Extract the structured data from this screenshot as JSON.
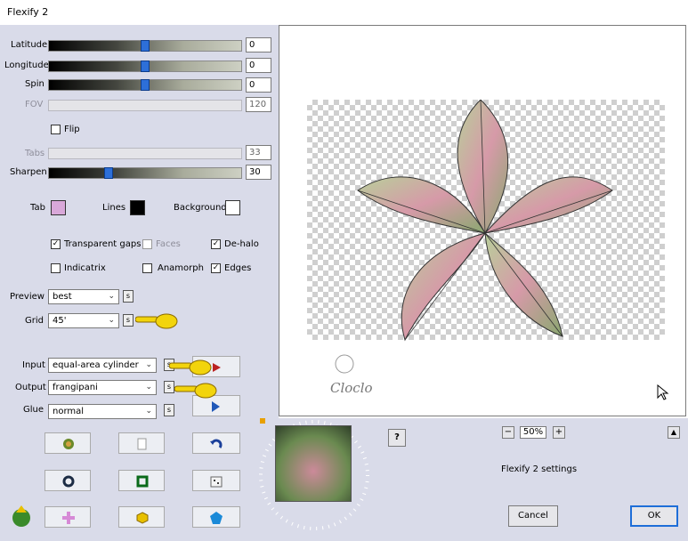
{
  "window": {
    "title": "Flexify 2"
  },
  "sliders": {
    "latitude": {
      "label": "Latitude",
      "value": "0",
      "level": 0.5
    },
    "longitude": {
      "label": "Longitude",
      "value": "0",
      "level": 0.5
    },
    "spin": {
      "label": "Spin",
      "value": "0",
      "level": 0.5
    },
    "fov": {
      "label": "FOV",
      "value": "120"
    },
    "tabs": {
      "label": "Tabs",
      "value": "33"
    },
    "sharpen": {
      "label": "Sharpen",
      "value": "30",
      "level": 0.3
    }
  },
  "flip": {
    "label": "Flip",
    "checked": false
  },
  "colors": {
    "tab": {
      "label": "Tab",
      "color": "#d9a8d9"
    },
    "lines": {
      "label": "Lines",
      "color": "#000000"
    },
    "background": {
      "label": "Background",
      "color": "#ffffff"
    }
  },
  "checkboxes": {
    "transparent_gaps": {
      "label": "Transparent gaps",
      "checked": true
    },
    "faces": {
      "label": "Faces",
      "checked": false
    },
    "dehalo": {
      "label": "De-halo",
      "checked": true
    },
    "indicatrix": {
      "label": "Indicatrix",
      "checked": false
    },
    "anamorph": {
      "label": "Anamorph",
      "checked": false
    },
    "edges": {
      "label": "Edges",
      "checked": true
    }
  },
  "selects": {
    "preview": {
      "label": "Preview",
      "value": "best"
    },
    "grid": {
      "label": "Grid",
      "value": "45'"
    },
    "input": {
      "label": "Input",
      "value": "equal-area cylinder"
    },
    "output": {
      "label": "Output",
      "value": "frangipani"
    },
    "glue": {
      "label": "Glue",
      "value": "normal"
    }
  },
  "s_label": "s",
  "watermark": {
    "text": "Cloclo"
  },
  "zoom": {
    "minus": "−",
    "value": "50%",
    "plus": "+"
  },
  "collapse_label": "▲",
  "help_label": "?",
  "settings_label": "Flexify 2 settings",
  "buttons": {
    "cancel": "Cancel",
    "ok": "OK"
  },
  "accent_color": "#2d6fd8"
}
